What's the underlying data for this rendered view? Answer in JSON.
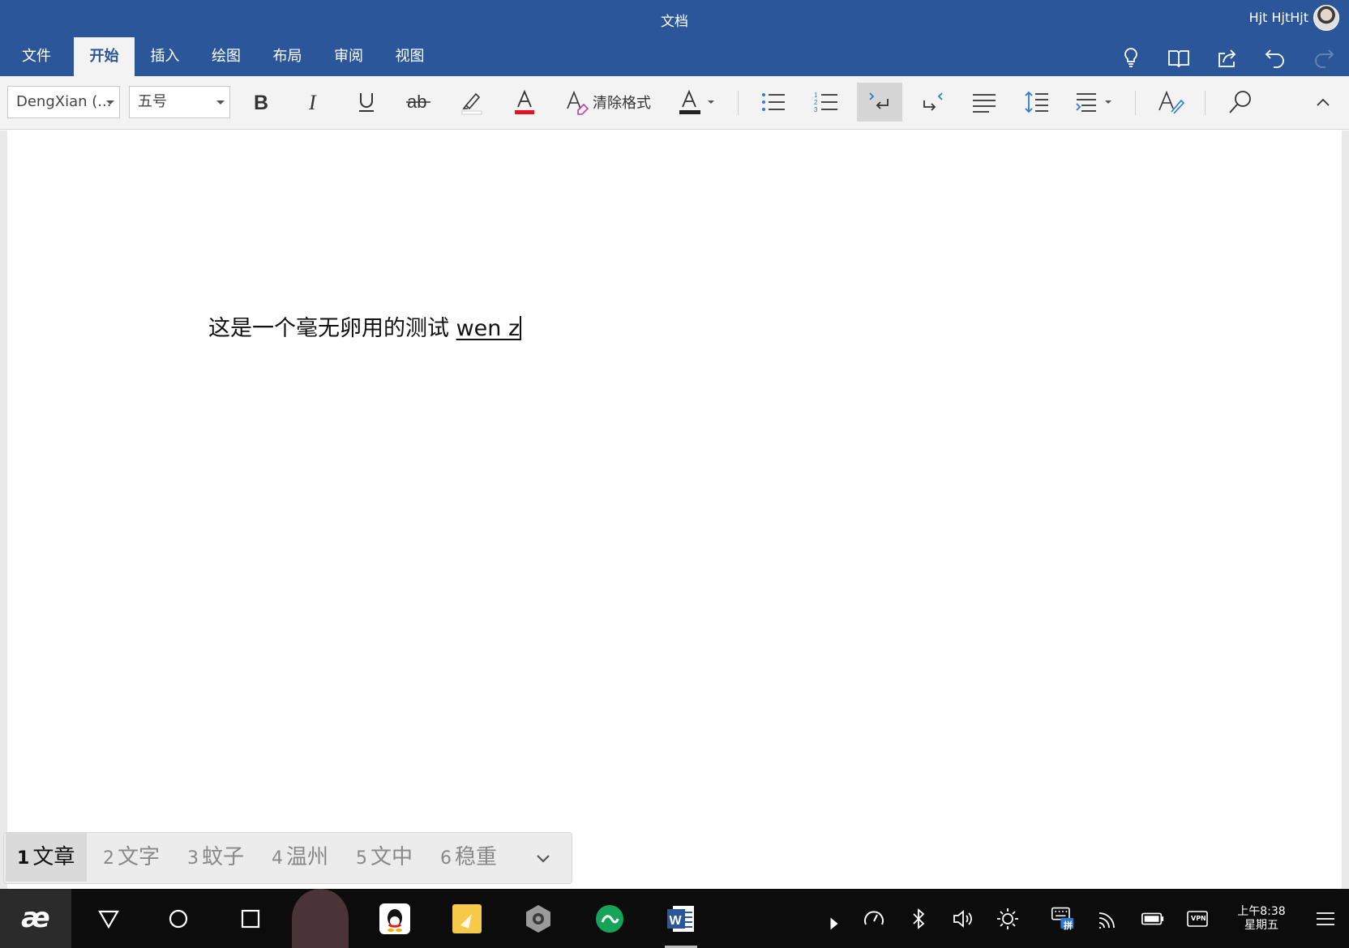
{
  "window": {
    "title": "文档",
    "user_name": "Hjt HjtHjt"
  },
  "tabs": [
    {
      "label": "文件"
    },
    {
      "label": "开始",
      "active": true
    },
    {
      "label": "插入"
    },
    {
      "label": "绘图"
    },
    {
      "label": "布局"
    },
    {
      "label": "审阅"
    },
    {
      "label": "视图"
    }
  ],
  "top_icons": [
    "lightbulb-icon",
    "reading-mode-icon",
    "share-icon",
    "undo-icon",
    "redo-icon"
  ],
  "ribbon": {
    "font_name": "DengXian (...",
    "font_size": "五号",
    "clear_format_label": "清除格式",
    "highlight_color": "#ffffff",
    "font_color": "#e81123",
    "shading_color": "#222222"
  },
  "document": {
    "text": "这是一个毫无卵用的测试 ",
    "composing_text": "wen z"
  },
  "ime": {
    "candidates": [
      {
        "num": "1",
        "text": "文章"
      },
      {
        "num": "2",
        "text": "文字"
      },
      {
        "num": "3",
        "text": "蚊子"
      },
      {
        "num": "4",
        "text": "温州"
      },
      {
        "num": "5",
        "text": "文中"
      },
      {
        "num": "6",
        "text": "稳重"
      }
    ]
  },
  "taskbar": {
    "start_label": "æ",
    "clock_time": "上午8:38",
    "clock_day": "星期五",
    "ime_badge": "拼",
    "vpn_label": "VPN"
  }
}
